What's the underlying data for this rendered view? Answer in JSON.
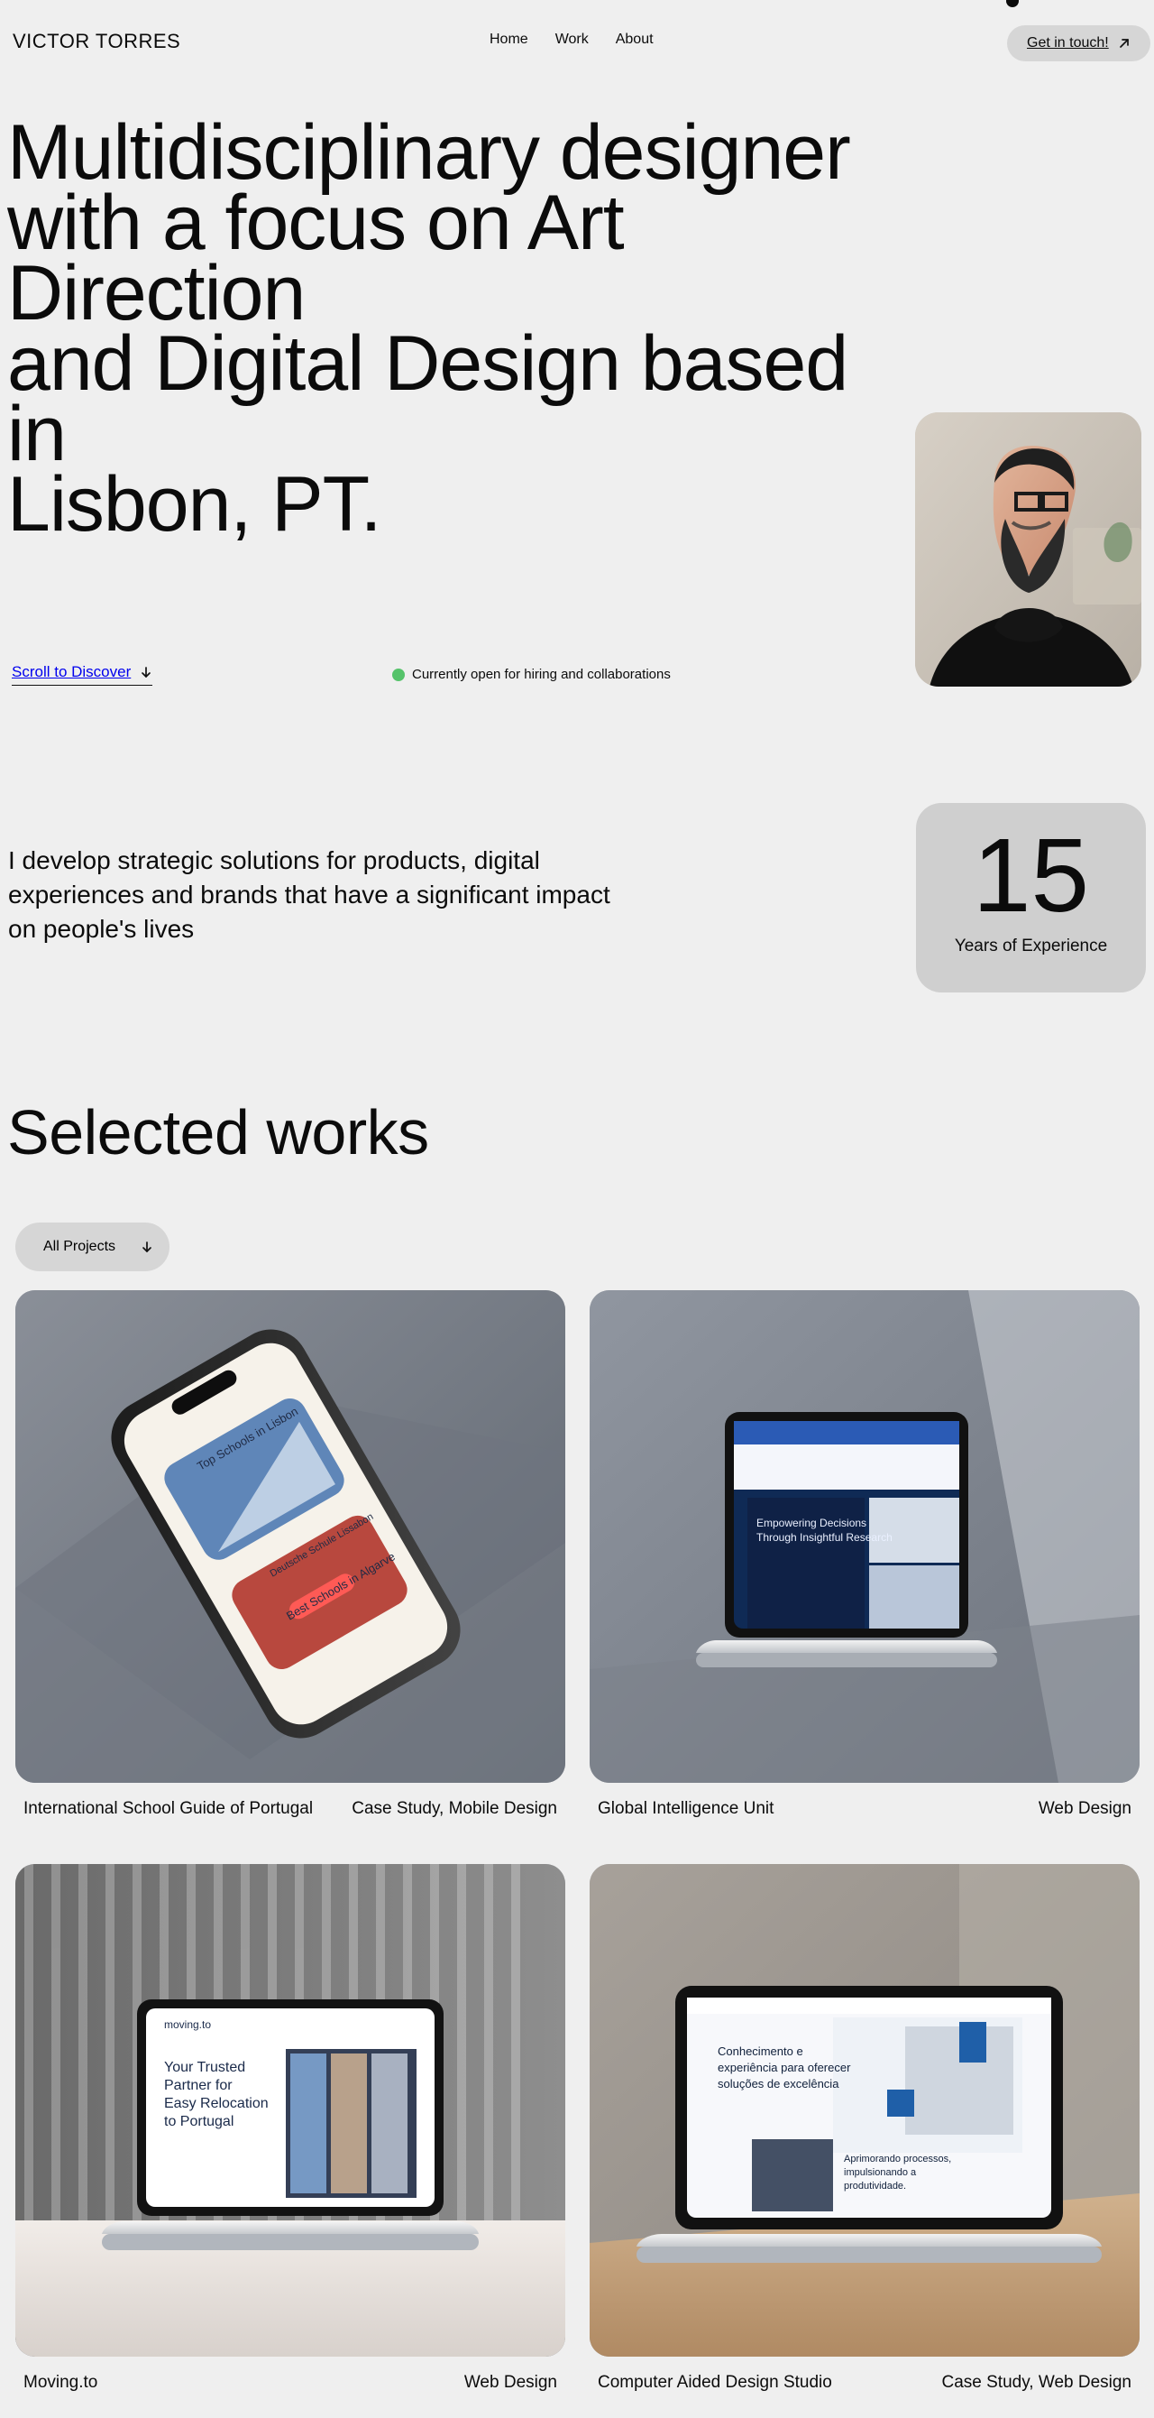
{
  "header": {
    "brand": "VICTOR TORRES",
    "nav": [
      {
        "label": "Home"
      },
      {
        "label": "Work"
      },
      {
        "label": "About"
      }
    ],
    "cta_label": "Get in touch!"
  },
  "hero": {
    "title_lines": [
      "Multidisciplinary designer",
      "with a focus on Art Direction",
      "and Digital Design based in",
      "Lisbon, PT."
    ],
    "scroll_label": "Scroll to Discover",
    "status_text": "Currently open for hiring and collaborations"
  },
  "intro": {
    "lead_lines": [
      "I develop strategic solutions for products, digital",
      "experiences and brands that have a significant impact",
      "on people's lives"
    ],
    "experience": {
      "value": "15",
      "label": "Years of Experience"
    }
  },
  "works": {
    "title": "Selected works",
    "filter_selected": "All Projects",
    "items": [
      {
        "name": "International School Guide of Portugal",
        "tags": "Case Study, Mobile Design",
        "mock": {
          "type": "phone",
          "lines": [
            "Top Schools in Lisbon",
            "Deutsche Schule Lissabon",
            "Best Schools in Algarve"
          ]
        }
      },
      {
        "name": "Global Intelligence Unit",
        "tags": "Web Design",
        "mock": {
          "type": "laptop",
          "lines": [
            "Empowering Decisions",
            "Through Insightful Research"
          ]
        }
      },
      {
        "name": "Moving.to",
        "tags": "Web Design",
        "mock": {
          "type": "laptop",
          "lines": [
            "moving.to",
            "Your Trusted",
            "Partner for",
            "Easy Relocation",
            "to Portugal"
          ]
        }
      },
      {
        "name": "Computer Aided Design Studio",
        "tags": "Case Study, Web Design",
        "mock": {
          "type": "laptop",
          "lines": [
            "Conhecimento e",
            "experiência para oferecer",
            "soluções de excelência",
            "Aprimorando processos,",
            "impulsionando a",
            "produtividade."
          ]
        }
      }
    ]
  },
  "colors": {
    "background": "#efefef",
    "pill": "#d6d6d6",
    "card": "#cfcfcf",
    "status_green": "#55c36a"
  }
}
